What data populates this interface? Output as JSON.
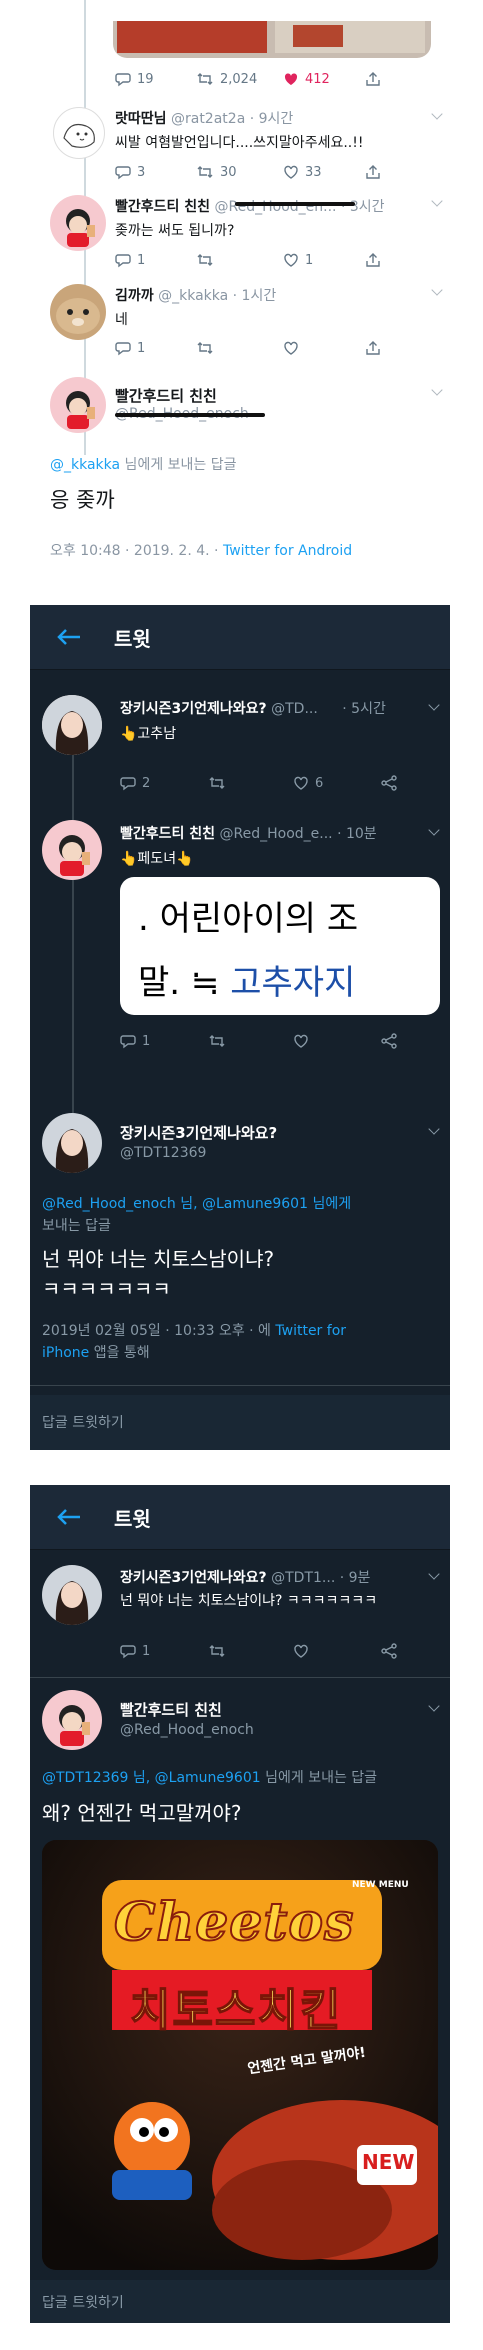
{
  "light": {
    "top_stats": {
      "replies": "19",
      "retweets": "2,024",
      "likes": "412"
    },
    "tweets": [
      {
        "name": "랏따딴님",
        "handle": "@rat2at2a",
        "time": "· 9시간",
        "text": "씨발 여혐발언입니다....쓰지말아주세요..!!",
        "replies": "3",
        "retweets": "30",
        "likes": "33"
      },
      {
        "name": "빨간후드티 친친",
        "handle": "@Red_Hood_en...",
        "time": "· 3시간",
        "text": "좆까는 써도 됩니까?",
        "replies": "1",
        "retweets": "",
        "likes": "1"
      },
      {
        "name": "김까까",
        "handle": "@_kkakka",
        "time": "· 1시간",
        "text": "네",
        "replies": "1",
        "retweets": "",
        "likes": ""
      }
    ],
    "main": {
      "name": "빨간후드티 친친",
      "handle": "@Red_Hood_enoch",
      "reply_to_handle": "@_kkakka",
      "reply_to_suffix": " 님에게 보내는 답글",
      "text": "응 좆까",
      "timestamp": "오후 10:48 · 2019. 2. 4. · ",
      "source": "Twitter for Android"
    }
  },
  "dark1": {
    "header": "트윗",
    "t1": {
      "name": "장키시즌3기언제나와요?",
      "handle": "@TD...",
      "time": "· 5시간",
      "text": "👆고추남",
      "replies": "2",
      "likes": "6"
    },
    "t2": {
      "name": "빨간후드티 친친",
      "handle": "@Red_Hood_e...",
      "time": "· 10분",
      "text": "👆페도녀👆",
      "replies": "1",
      "img_line1": ". 어린아이의 조",
      "img_line2a": "말. ≒",
      "img_line2b": "고추자지"
    },
    "main": {
      "name": "장키시즌3기언제나와요?",
      "handle": "@TDT12369",
      "reply_line1": "@Red_Hood_enoch 님, @Lamune9601 님에게",
      "reply_line2": "보내는 답글",
      "text1": "넌 뭐야 너는 치토스남이냐?",
      "text2": "ㅋㅋㅋㅋㅋㅋㅋ",
      "date": "2019년 02월 05일 · 10:33 오후 · 에 ",
      "source": "Twitter for",
      "source2": "iPhone",
      "source_suffix": " 앱을 통해"
    },
    "reply_prompt": "답글 트윗하기"
  },
  "dark2": {
    "header": "트윗",
    "t1": {
      "name": "장키시즌3기언제나와요?",
      "handle": "@TDT1...",
      "time": "· 9분",
      "text": "넌 뭐야 너는 치토스남이냐? ㅋㅋㅋㅋㅋㅋㅋ",
      "replies": "1"
    },
    "main": {
      "name": "빨간후드티 친친",
      "handle": "@Red_Hood_enoch",
      "reply_handles": "@TDT12369 님, @Lamune9601",
      "reply_suffix": " 님에게 보내는 답글",
      "text": "왜? 언젠간 먹고말꺼야?",
      "img_brand": "Cheetos",
      "img_korean": "치토스치킨",
      "img_new_menu": "NEW MENU",
      "img_new": "NEW",
      "img_slogan": "언젠간 먹고 말꺼야!"
    },
    "reply_prompt": "답글 트윗하기"
  },
  "colors": {
    "twitter_blue": "#1da1f2",
    "like_red": "#e0245e",
    "dark_bg": "#15202b"
  }
}
